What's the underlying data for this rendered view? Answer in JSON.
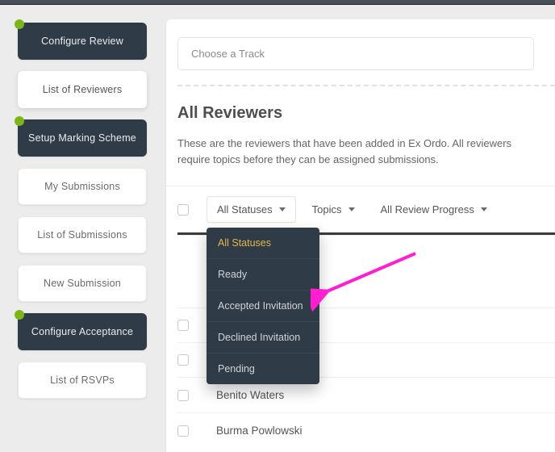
{
  "sidebar": {
    "items": [
      {
        "label": "Configure Review",
        "style": "dark",
        "dot": true
      },
      {
        "label": "List of Reviewers",
        "style": "active",
        "dot": false
      },
      {
        "label": "Setup Marking Scheme",
        "style": "dark",
        "dot": true
      },
      {
        "label": "My Submissions",
        "style": "light",
        "dot": false
      },
      {
        "label": "List of Submissions",
        "style": "light",
        "dot": false
      },
      {
        "label": "New Submission",
        "style": "light",
        "dot": false
      },
      {
        "label": "Configure Acceptance",
        "style": "dark",
        "dot": true
      },
      {
        "label": "List of RSVPs",
        "style": "light",
        "dot": false
      }
    ]
  },
  "track": {
    "placeholder": "Choose a Track"
  },
  "heading": "All Reviewers",
  "description": "These are the reviewers that have been added in Ex Ordo. All reviewers require topics before they can be assigned submissions.",
  "filters": {
    "status": {
      "label": "All Statuses",
      "options": [
        "All Statuses",
        "Ready",
        "Accepted Invitation",
        "Declined Invitation",
        "Pending"
      ]
    },
    "topics": {
      "label": "Topics"
    },
    "progress": {
      "label": "All Review Progress"
    }
  },
  "reviewers": [
    {
      "name": ""
    },
    {
      "name": ""
    },
    {
      "name": "Benito Waters"
    },
    {
      "name": "Burma Powlowski"
    }
  ],
  "annotation": {
    "color": "#ff1fd1"
  }
}
